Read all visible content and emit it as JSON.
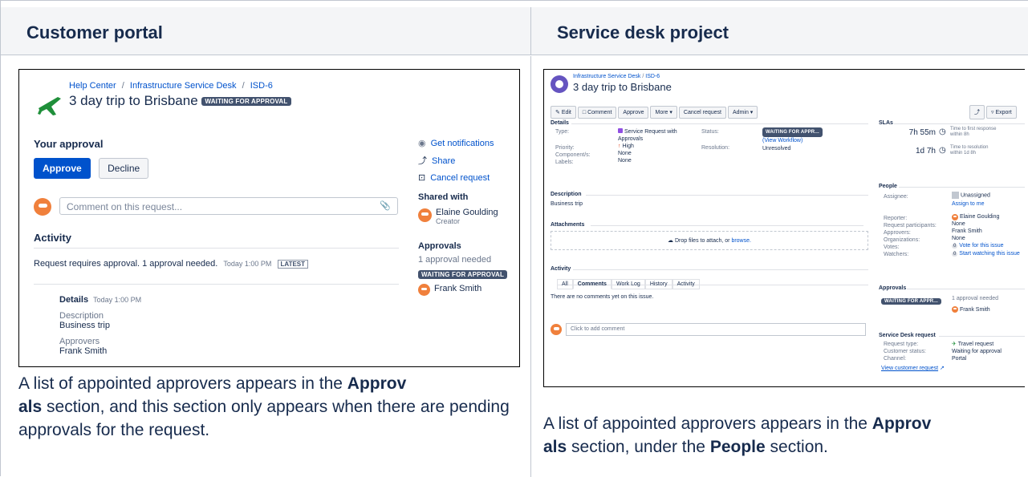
{
  "headers": {
    "left": "Customer portal",
    "right": "Service desk project"
  },
  "captions": {
    "left": {
      "pre": "A list of appointed approvers appears in the ",
      "b1": "Approv",
      "b2": "als",
      "post": " section, and this section only appears when there are pending approvals for the request."
    },
    "right": {
      "pre": "A list of appointed approvers appears in the ",
      "b1": "Approv",
      "b2": "als",
      "mid": " section, under the ",
      "b3": "People",
      "post": " section."
    }
  },
  "portal": {
    "breadcrumb": [
      "Help Center",
      "Infrastructure Service Desk",
      "ISD-6"
    ],
    "sep": "/",
    "title": "3 day trip to Brisbane",
    "status": "WAITING FOR APPROVAL",
    "your_approval": "Your approval",
    "approve": "Approve",
    "decline": "Decline",
    "comment_placeholder": "Comment on this request...",
    "activity": "Activity",
    "activity_text": "Request requires approval. 1 approval needed.",
    "activity_time": "Today 1:00 PM",
    "latest": "LATEST",
    "details": "Details",
    "details_time": "Today 1:00 PM",
    "desc_label": "Description",
    "desc_value": "Business trip",
    "approvers_label": "Approvers",
    "approvers_value": "Frank Smith",
    "get_notifications": "Get notifications",
    "share": "Share",
    "cancel_request": "Cancel request",
    "shared_with": "Shared with",
    "shared_name": "Elaine Goulding",
    "shared_role": "Creator",
    "approvals": "Approvals",
    "approvals_needed": "1 approval needed",
    "approvals_status": "WAITING FOR APPROVAL",
    "approver_name": "Frank Smith"
  },
  "sd": {
    "breadcrumb": [
      "Infrastructure Service Desk",
      "ISD-6"
    ],
    "sep": "/",
    "title": "3 day trip to Brisbane",
    "toolbar": [
      "Edit",
      "Comment",
      "Approve",
      "More",
      "Cancel request",
      "Admin"
    ],
    "export": "Export",
    "details": "Details",
    "fields": {
      "type_l": "Type:",
      "type_v": "Service Request with Approvals",
      "priority_l": "Priority:",
      "priority_v": "High",
      "comp_l": "Component/s:",
      "comp_v": "None",
      "labels_l": "Labels:",
      "labels_v": "None",
      "status_l": "Status:",
      "status_v": "WAITING FOR APPR...",
      "view_workflow": "(View Workflow)",
      "res_l": "Resolution:",
      "res_v": "Unresolved"
    },
    "description": "Description",
    "desc_value": "Business trip",
    "attachments": "Attachments",
    "drop_text": "Drop files to attach, or",
    "browse": "browse.",
    "activity": "Activity",
    "tabs": [
      "All",
      "Comments",
      "Work Log",
      "History",
      "Activity"
    ],
    "no_comments": "There are no comments yet on this issue.",
    "add_comment": "Click to add comment",
    "slas": "SLAs",
    "sla1_time": "7h 55m",
    "sla1_a": "Time to first response",
    "sla1_b": "within 8h",
    "sla2_time": "1d 7h",
    "sla2_a": "Time to resolution",
    "sla2_b": "within 1d 8h",
    "people": "People",
    "assignee_l": "Assignee:",
    "assignee_v": "Unassigned",
    "assign_me": "Assign to me",
    "reporter_l": "Reporter:",
    "reporter_v": "Elaine Goulding",
    "participants_l": "Request participants:",
    "participants_v": "None",
    "approvers_l": "Approvers:",
    "approvers_v": "Frank Smith",
    "orgs_l": "Organizations:",
    "orgs_v": "None",
    "votes_l": "Votes:",
    "votes_count": "0",
    "votes_v": "Vote for this issue",
    "watchers_l": "Watchers:",
    "watchers_count": "0",
    "watchers_v": "Start watching this issue",
    "approvals": "Approvals",
    "appr_status": "WAITING FOR APPR...",
    "appr_needed": "1 approval needed",
    "appr_name": "Frank Smith",
    "sdr": "Service Desk request",
    "rt_l": "Request type:",
    "rt_v": "Travel request",
    "cs_l": "Customer status:",
    "cs_v": "Waiting for approval",
    "ch_l": "Channel:",
    "ch_v": "Portal",
    "view_customer": "View customer request"
  }
}
